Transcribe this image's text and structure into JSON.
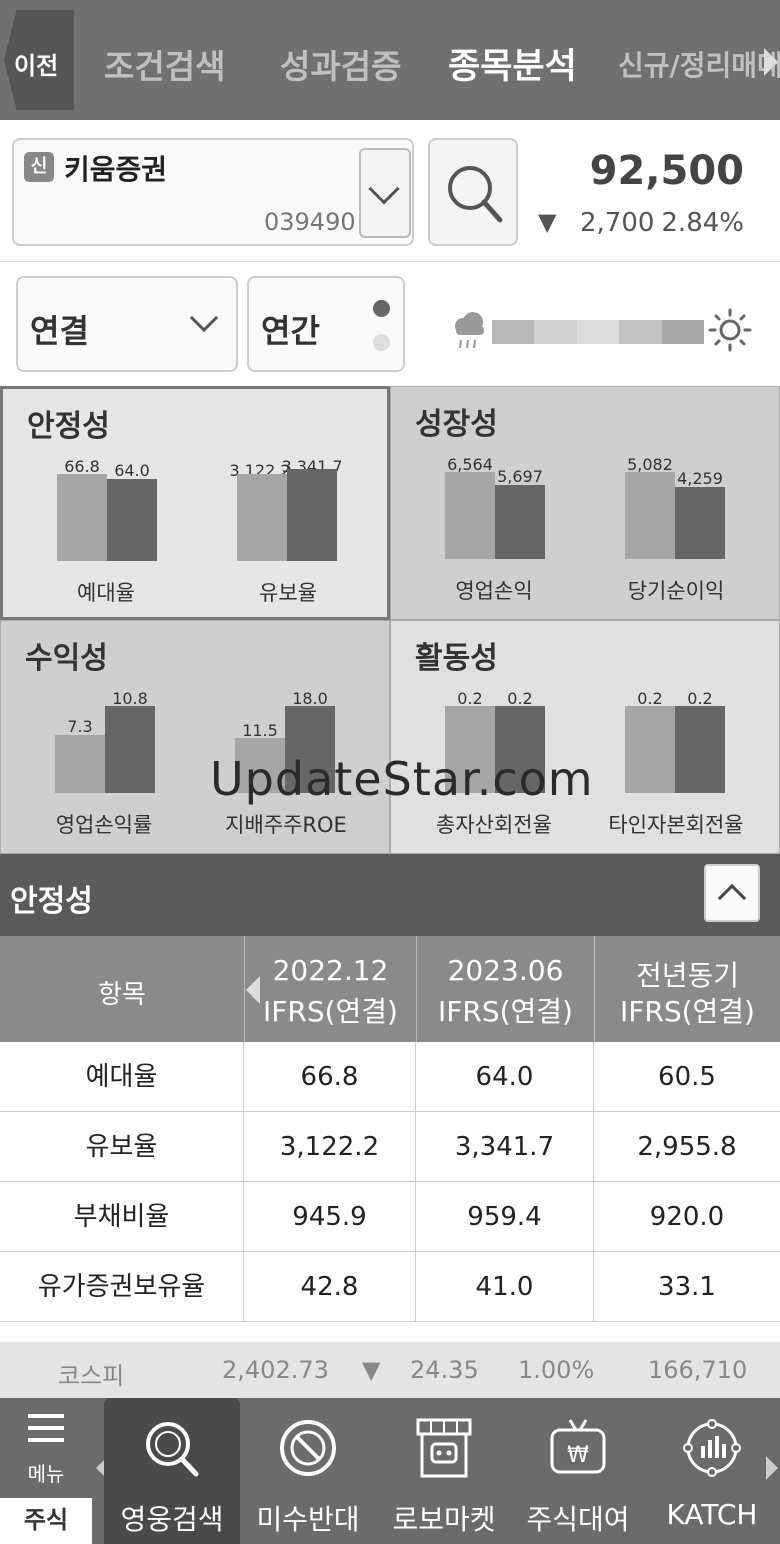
{
  "nav": {
    "back": "이전",
    "tabs": [
      "조건검색",
      "성과검증",
      "종목분석",
      "신규/정리매매"
    ],
    "active_index": 2
  },
  "stock": {
    "badge": "신",
    "name": "키움증권",
    "code": "039490",
    "price": "92,500",
    "change_arrow": "▼",
    "change": "2,700",
    "change_pct": "2.84%"
  },
  "filters": {
    "consolidation": "연결",
    "period": "연간"
  },
  "metrics": [
    {
      "title": "안정성",
      "selected": true,
      "items": [
        {
          "label": "예대율",
          "v1": "66.8",
          "v2": "64.0",
          "h1": 0.7,
          "h2": 0.66
        },
        {
          "label": "유보율",
          "v1": "3,122.2",
          "v2": "3,341.7",
          "h1": 0.7,
          "h2": 0.74
        }
      ]
    },
    {
      "title": "성장성",
      "selected": false,
      "items": [
        {
          "label": "영업손익",
          "v1": "6,564",
          "v2": "5,697",
          "h1": 0.7,
          "h2": 0.6
        },
        {
          "label": "당기순이익",
          "v1": "5,082",
          "v2": "4,259",
          "h1": 0.7,
          "h2": 0.58
        }
      ]
    },
    {
      "title": "수익성",
      "selected": false,
      "items": [
        {
          "label": "영업손익률",
          "v1": "7.3",
          "v2": "10.8",
          "h1": 0.47,
          "h2": 0.7
        },
        {
          "label": "지배주주ROE",
          "v1": "11.5",
          "v2": "18.0",
          "h1": 0.44,
          "h2": 0.7
        }
      ]
    },
    {
      "title": "활동성",
      "selected": false,
      "items": [
        {
          "label": "총자산회전율",
          "v1": "0.2",
          "v2": "0.2",
          "h1": 0.7,
          "h2": 0.7
        },
        {
          "label": "타인자본회전율",
          "v1": "0.2",
          "v2": "0.2",
          "h1": 0.7,
          "h2": 0.7
        }
      ]
    }
  ],
  "watermark": "UpdateStar.com",
  "section": {
    "title": "안정성"
  },
  "table": {
    "item_header": "항목",
    "columns": [
      {
        "line1": "2022.12",
        "line2": "IFRS(연결)"
      },
      {
        "line1": "2023.06",
        "line2": "IFRS(연결)"
      },
      {
        "line1": "전년동기",
        "line2": "IFRS(연결)"
      }
    ],
    "rows": [
      {
        "label": "예대율",
        "values": [
          "66.8",
          "64.0",
          "60.5"
        ]
      },
      {
        "label": "유보율",
        "values": [
          "3,122.2",
          "3,341.7",
          "2,955.8"
        ]
      },
      {
        "label": "부채비율",
        "values": [
          "945.9",
          "959.4",
          "920.0"
        ]
      },
      {
        "label": "유가증권보유율",
        "values": [
          "42.8",
          "41.0",
          "33.1"
        ]
      }
    ]
  },
  "ticker": {
    "name": "코스피",
    "value": "2,402.73",
    "arrow": "▼",
    "change": "24.35",
    "pct": "1.00%",
    "volume": "166,710"
  },
  "bottom": {
    "menu_label": "메뉴",
    "stock_tab": "주식",
    "tabs": [
      {
        "label": "영웅검색",
        "icon": "magnifier-icon",
        "active": true
      },
      {
        "label": "미수반대",
        "icon": "prohibited-icon",
        "active": false
      },
      {
        "label": "로보마켓",
        "icon": "robot-store-icon",
        "active": false
      },
      {
        "label": "주식대여",
        "icon": "tv-won-icon",
        "active": false
      },
      {
        "label": "KATCH",
        "icon": "chart-bulb-icon",
        "active": false
      }
    ]
  },
  "colors": {
    "nav_bg": "#707070",
    "bar_light": "#a6a6a6",
    "bar_dark": "#666666",
    "section_bg": "#5a5a5a",
    "table_head_bg": "#8a8a8a"
  }
}
